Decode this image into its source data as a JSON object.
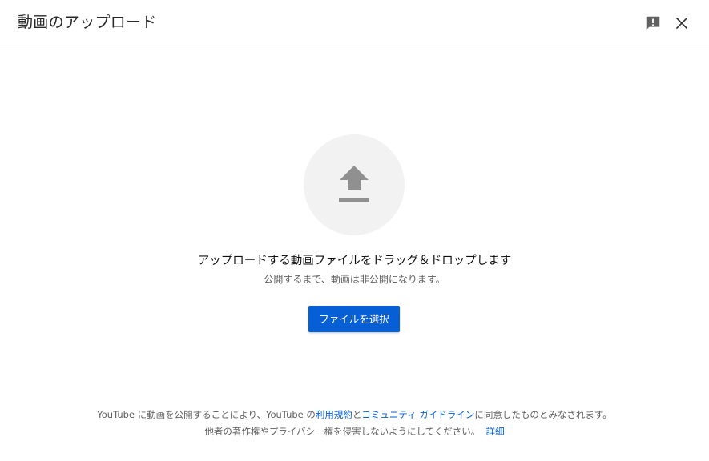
{
  "dialog": {
    "title": "動画のアップロード"
  },
  "upload": {
    "main_text": "アップロードする動画ファイルをドラッグ＆ドロップします",
    "sub_text": "公開するまで、動画は非公開になります。",
    "button_label": "ファイルを選択"
  },
  "footer": {
    "line1_part1": "YouTube に動画を公開することにより、YouTube の",
    "terms_link": "利用規約",
    "line1_and": "と",
    "guidelines_link": "コミュニティ ガイドライン",
    "line1_part2": "に同意したものとみなされます。",
    "line2_text": "他者の著作権やプライバシー権を侵害しないようにしてください。",
    "details_link": "詳細"
  },
  "icons": {
    "feedback": "feedback-icon",
    "close": "close-icon",
    "upload": "upload-arrow-icon"
  },
  "colors": {
    "accent": "#065fd4",
    "icon_gray": "#909090",
    "circle_bg": "#f2f2f2"
  }
}
